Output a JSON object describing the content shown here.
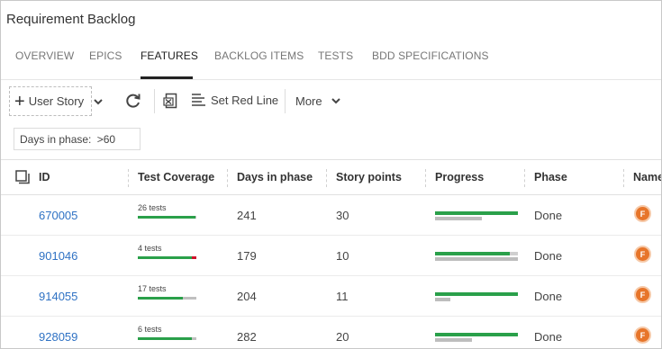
{
  "title": "Requirement Backlog",
  "tabs": [
    {
      "label": "OVERVIEW"
    },
    {
      "label": "EPICS"
    },
    {
      "label": "FEATURES",
      "active": true
    },
    {
      "label": "BACKLOG ITEMS"
    },
    {
      "label": "TESTS"
    },
    {
      "label": "BDD SPECIFICATIONS"
    }
  ],
  "toolbar": {
    "add_label": "User Story",
    "set_red_line_label": "Set Red Line",
    "more_label": "More"
  },
  "filter": {
    "label": "Days in phase:",
    "value": ">60"
  },
  "columns": {
    "id": "ID",
    "test_coverage": "Test Coverage",
    "days_in_phase": "Days in phase",
    "story_points": "Story points",
    "progress": "Progress",
    "phase": "Phase",
    "name": "Name"
  },
  "rows": [
    {
      "id": "670005",
      "tests": "26 tests",
      "coverage_pass": 0.98,
      "coverage_fail": 0.0,
      "days": "241",
      "points": "30",
      "progress_top": 1.0,
      "progress_bottom": 0.57,
      "phase": "Done",
      "avatar": "F"
    },
    {
      "id": "901046",
      "tests": "4 tests",
      "coverage_pass": 0.92,
      "coverage_fail": 0.08,
      "days": "179",
      "points": "10",
      "progress_top": 0.9,
      "progress_bottom": 1.0,
      "phase": "Done",
      "avatar": "F"
    },
    {
      "id": "914055",
      "tests": "17 tests",
      "coverage_pass": 0.77,
      "coverage_fail": 0.0,
      "days": "204",
      "points": "11",
      "progress_top": 1.0,
      "progress_bottom": 0.18,
      "phase": "Done",
      "avatar": "F"
    },
    {
      "id": "928059",
      "tests": "6 tests",
      "coverage_pass": 0.93,
      "coverage_fail": 0.0,
      "days": "282",
      "points": "20",
      "progress_top": 1.0,
      "progress_bottom": 0.45,
      "phase": "Done",
      "avatar": "F"
    }
  ],
  "colors": {
    "link": "#2f72c4",
    "pass": "#2aa04a",
    "fail": "#d0112b",
    "avatar": "#e7752a"
  }
}
